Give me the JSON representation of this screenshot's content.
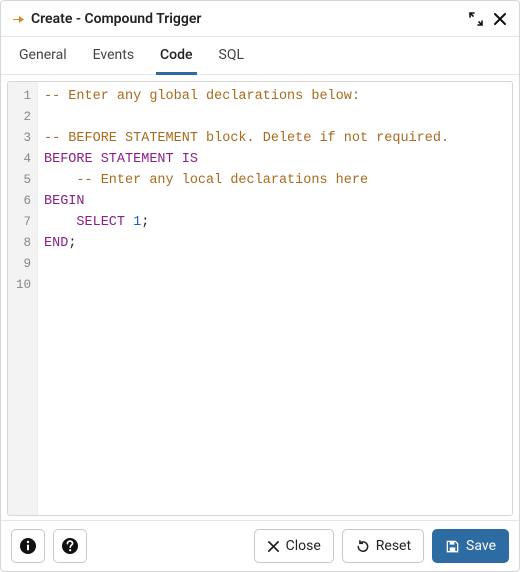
{
  "dialog": {
    "title": "Create - Compound Trigger"
  },
  "tabs": {
    "items": [
      {
        "label": "General",
        "active": false
      },
      {
        "label": "Events",
        "active": false
      },
      {
        "label": "Code",
        "active": true
      },
      {
        "label": "SQL",
        "active": false
      }
    ]
  },
  "editor": {
    "line_count": 10,
    "lines": [
      {
        "n": 1,
        "tokens": [
          {
            "cls": "tok-comment",
            "text": "-- Enter any global declarations below:"
          }
        ]
      },
      {
        "n": 2,
        "tokens": []
      },
      {
        "n": 3,
        "tokens": [
          {
            "cls": "tok-comment",
            "text": "-- BEFORE STATEMENT block. Delete if not required."
          }
        ]
      },
      {
        "n": 4,
        "tokens": [
          {
            "cls": "tok-keyword",
            "text": "BEFORE STATEMENT IS"
          }
        ]
      },
      {
        "n": 5,
        "tokens": [
          {
            "cls": "tok-ident",
            "text": "    "
          },
          {
            "cls": "tok-comment",
            "text": "-- Enter any local declarations here"
          }
        ]
      },
      {
        "n": 6,
        "tokens": [
          {
            "cls": "tok-keyword",
            "text": "BEGIN"
          }
        ]
      },
      {
        "n": 7,
        "tokens": [
          {
            "cls": "tok-ident",
            "text": "    "
          },
          {
            "cls": "tok-keyword",
            "text": "SELECT"
          },
          {
            "cls": "tok-ident",
            "text": " "
          },
          {
            "cls": "tok-num",
            "text": "1"
          },
          {
            "cls": "tok-punc",
            "text": ";"
          }
        ]
      },
      {
        "n": 8,
        "tokens": [
          {
            "cls": "tok-keyword",
            "text": "END"
          },
          {
            "cls": "tok-punc",
            "text": ";"
          }
        ]
      },
      {
        "n": 9,
        "tokens": []
      },
      {
        "n": 10,
        "tokens": []
      }
    ]
  },
  "footer": {
    "close_label": "Close",
    "reset_label": "Reset",
    "save_label": "Save"
  },
  "colors": {
    "accent": "#2d6ca2",
    "comment": "#a86b1e",
    "keyword": "#8a208a",
    "number": "#1565c0"
  }
}
